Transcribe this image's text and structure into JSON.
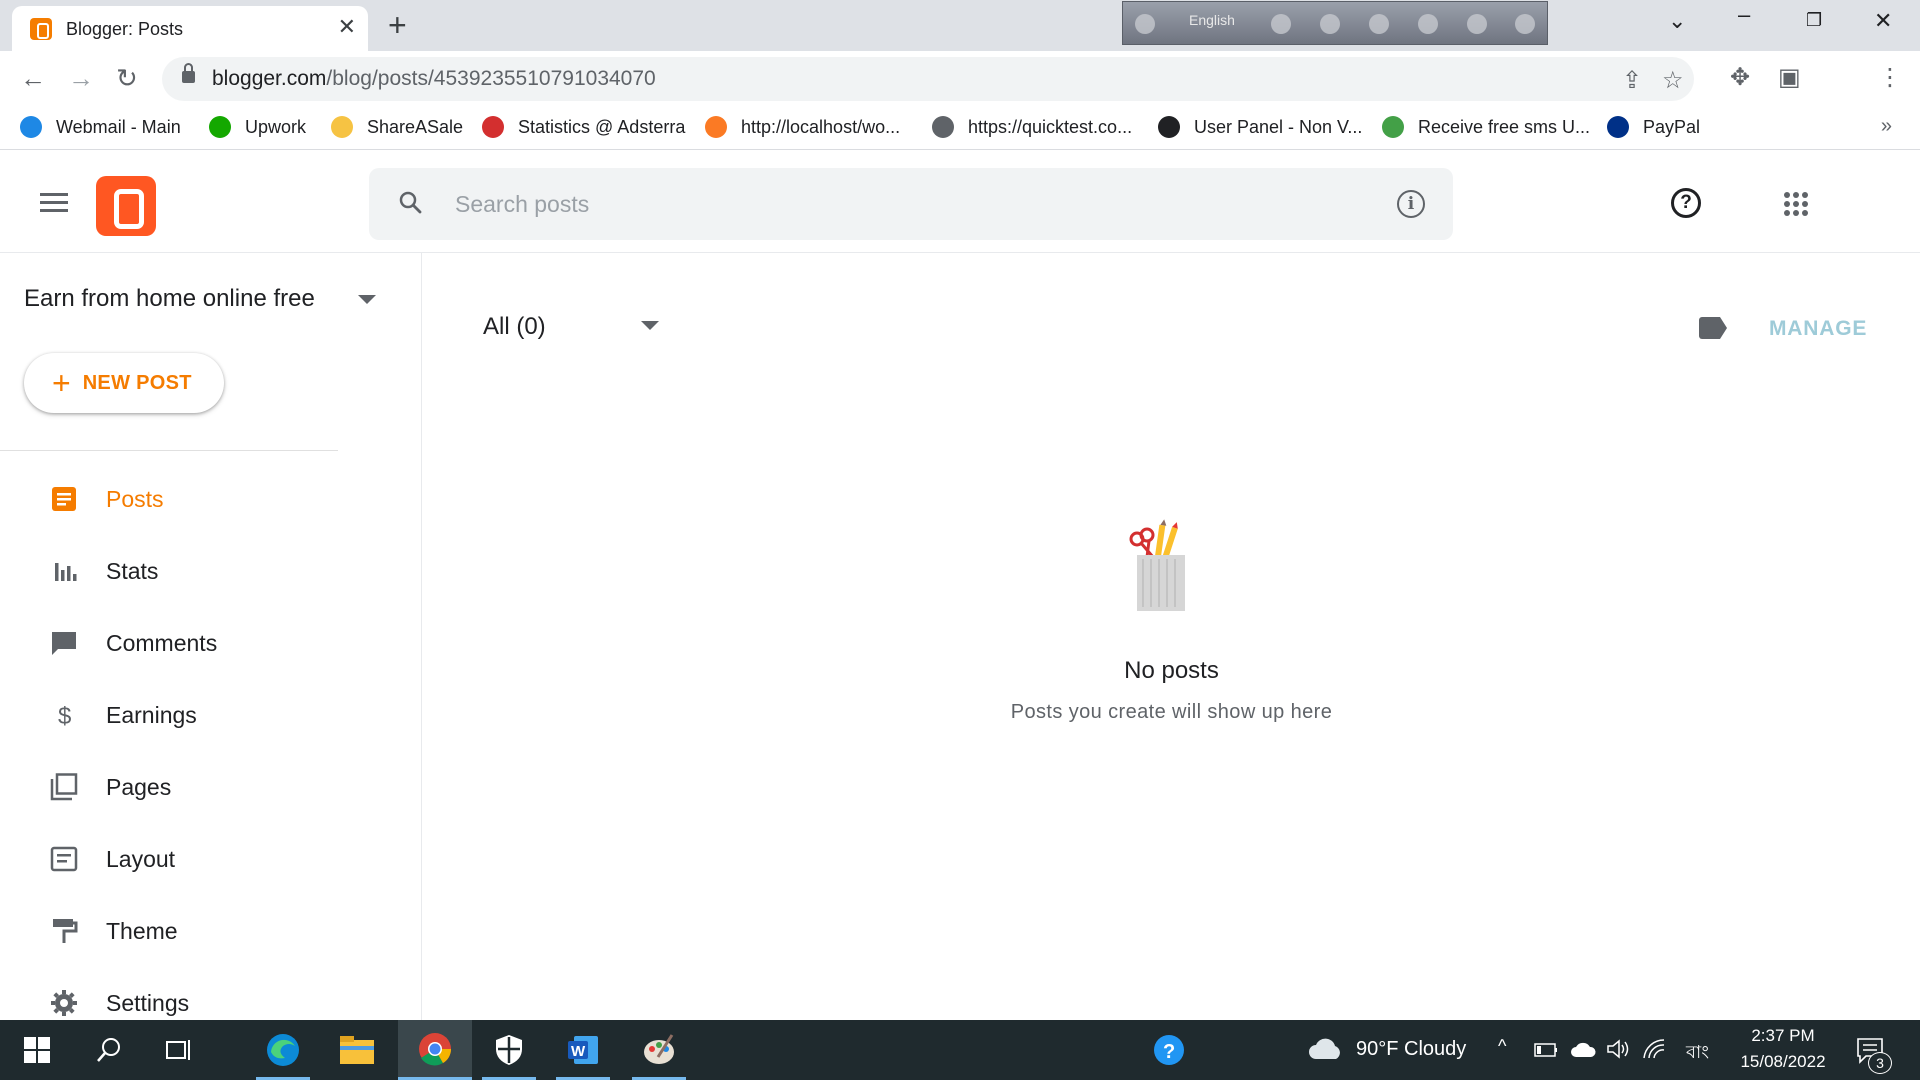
{
  "browser": {
    "tab_title": "Blogger: Posts",
    "tab_close": "✕",
    "new_tab": "+",
    "url_domain": "blogger.com",
    "url_path": "/blog/posts/4539235510791034070",
    "language_bar": "English",
    "bookmarks": [
      {
        "label": "Webmail - Main",
        "color": "#1e88e5"
      },
      {
        "label": "Upwork",
        "color": "#14a800"
      },
      {
        "label": "ShareASale",
        "color": "#f6c343"
      },
      {
        "label": "Statistics @ Adsterra",
        "color": "#d32f2f"
      },
      {
        "label": "http://localhost/wo...",
        "color": "#fb7a24"
      },
      {
        "label": "https://quicktest.co...",
        "color": "#5f6368"
      },
      {
        "label": "User Panel - Non V...",
        "color": "#202124"
      },
      {
        "label": "Receive free sms U...",
        "color": "#43a047"
      },
      {
        "label": "PayPal",
        "color": "#003087"
      }
    ],
    "bookmarks_more": "»"
  },
  "app": {
    "search_placeholder": "Search posts",
    "blog_name": "Earn from home online free",
    "new_post_plus": "+",
    "new_post_label": "NEW POST",
    "nav": [
      {
        "label": "Posts",
        "icon": "posts-icon",
        "active": true
      },
      {
        "label": "Stats",
        "icon": "stats-icon",
        "active": false
      },
      {
        "label": "Comments",
        "icon": "comments-icon",
        "active": false
      },
      {
        "label": "Earnings",
        "icon": "earnings-icon",
        "active": false
      },
      {
        "label": "Pages",
        "icon": "pages-icon",
        "active": false
      },
      {
        "label": "Layout",
        "icon": "layout-icon",
        "active": false
      },
      {
        "label": "Theme",
        "icon": "theme-icon",
        "active": false
      },
      {
        "label": "Settings",
        "icon": "settings-icon",
        "active": false
      }
    ],
    "filter_label": "All (0)",
    "manage_label": "MANAGE",
    "empty_title": "No posts",
    "empty_subtitle": "Posts you create will show up here",
    "accent_color": "#f57c00"
  },
  "taskbar": {
    "weather": "90°F  Cloudy",
    "lang": "বাং",
    "time": "2:37 PM",
    "date": "15/08/2022",
    "notifications": "3"
  }
}
